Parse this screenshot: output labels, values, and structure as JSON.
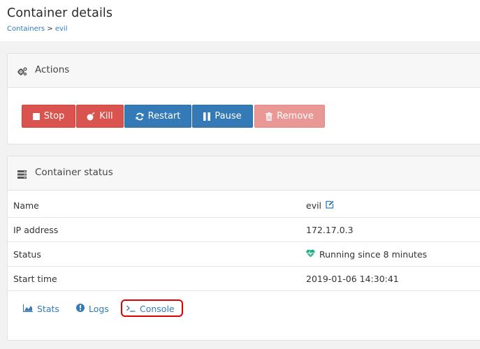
{
  "header": {
    "title": "Container details",
    "breadcrumb": {
      "parent": "Containers",
      "separator": ">",
      "current": "evil"
    }
  },
  "actions_panel": {
    "title": "Actions",
    "icon": "cogs-icon",
    "buttons": [
      {
        "label": "Stop",
        "icon": "stop-icon",
        "style": "danger"
      },
      {
        "label": "Kill",
        "icon": "bomb-icon",
        "style": "danger"
      },
      {
        "label": "Restart",
        "icon": "refresh-icon",
        "style": "primary"
      },
      {
        "label": "Pause",
        "icon": "pause-icon",
        "style": "primary"
      },
      {
        "label": "Remove",
        "icon": "trash-icon",
        "style": "danger-disabled"
      }
    ]
  },
  "status_panel": {
    "title": "Container status",
    "icon": "server-icon",
    "rows": [
      {
        "label": "Name",
        "value": "evil",
        "icon": "edit-icon"
      },
      {
        "label": "IP address",
        "value": "172.17.0.3"
      },
      {
        "label": "Status",
        "value": "Running since 8 minutes",
        "icon": "heartbeat-icon"
      },
      {
        "label": "Start time",
        "value": "2019-01-06 14:30:41"
      }
    ],
    "links": [
      {
        "label": "Stats",
        "icon": "area-chart-icon"
      },
      {
        "label": "Logs",
        "icon": "info-circle-icon"
      },
      {
        "label": "Console",
        "icon": "terminal-icon",
        "highlighted": true
      }
    ]
  },
  "colors": {
    "danger": "#d9534f",
    "primary": "#337ab7",
    "disabled": "#e99895",
    "link": "#337ab7",
    "heartbeat": "#23ae89",
    "highlight": "#e00000"
  }
}
